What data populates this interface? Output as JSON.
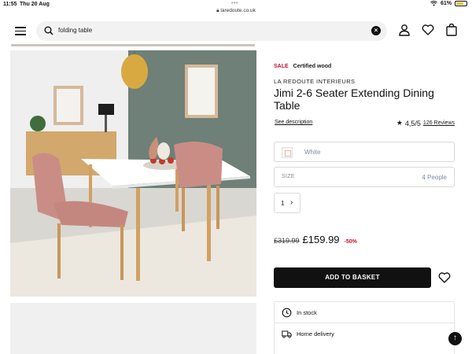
{
  "status_bar": {
    "time": "11:55",
    "date": "Thu 20 Aug",
    "url": "laredoute.co.uk",
    "battery": "61%",
    "battery_level": 0.61
  },
  "header": {
    "search_value": "folding table",
    "icons": [
      "menu-icon",
      "search-icon",
      "clear-icon",
      "account-icon",
      "heart-icon",
      "bag-icon"
    ]
  },
  "product": {
    "badge_sale": "SALE",
    "badge_certified": "Certified wood",
    "brand": "LA REDOUTE INTERIEURS",
    "title": "Jimi 2-6 Seater Extending Dining Table",
    "see_description": "See description",
    "rating": "4,5/5",
    "reviews": "126 Reviews",
    "color": "White",
    "size_label": "SIZE",
    "size_value": "4 People",
    "quantity": "1",
    "old_price": "£319.99",
    "new_price": "£159.99",
    "discount": "-50%",
    "add_to_basket": "ADD TO BASKET",
    "availability": [
      {
        "label": "In stock",
        "icon": "clock-icon"
      },
      {
        "label": "Home delivery",
        "icon": "truck-icon"
      }
    ]
  },
  "colors": {
    "sale_red": "#c8102e",
    "button_black": "#111111",
    "muted_blue": "#7b88a8"
  }
}
